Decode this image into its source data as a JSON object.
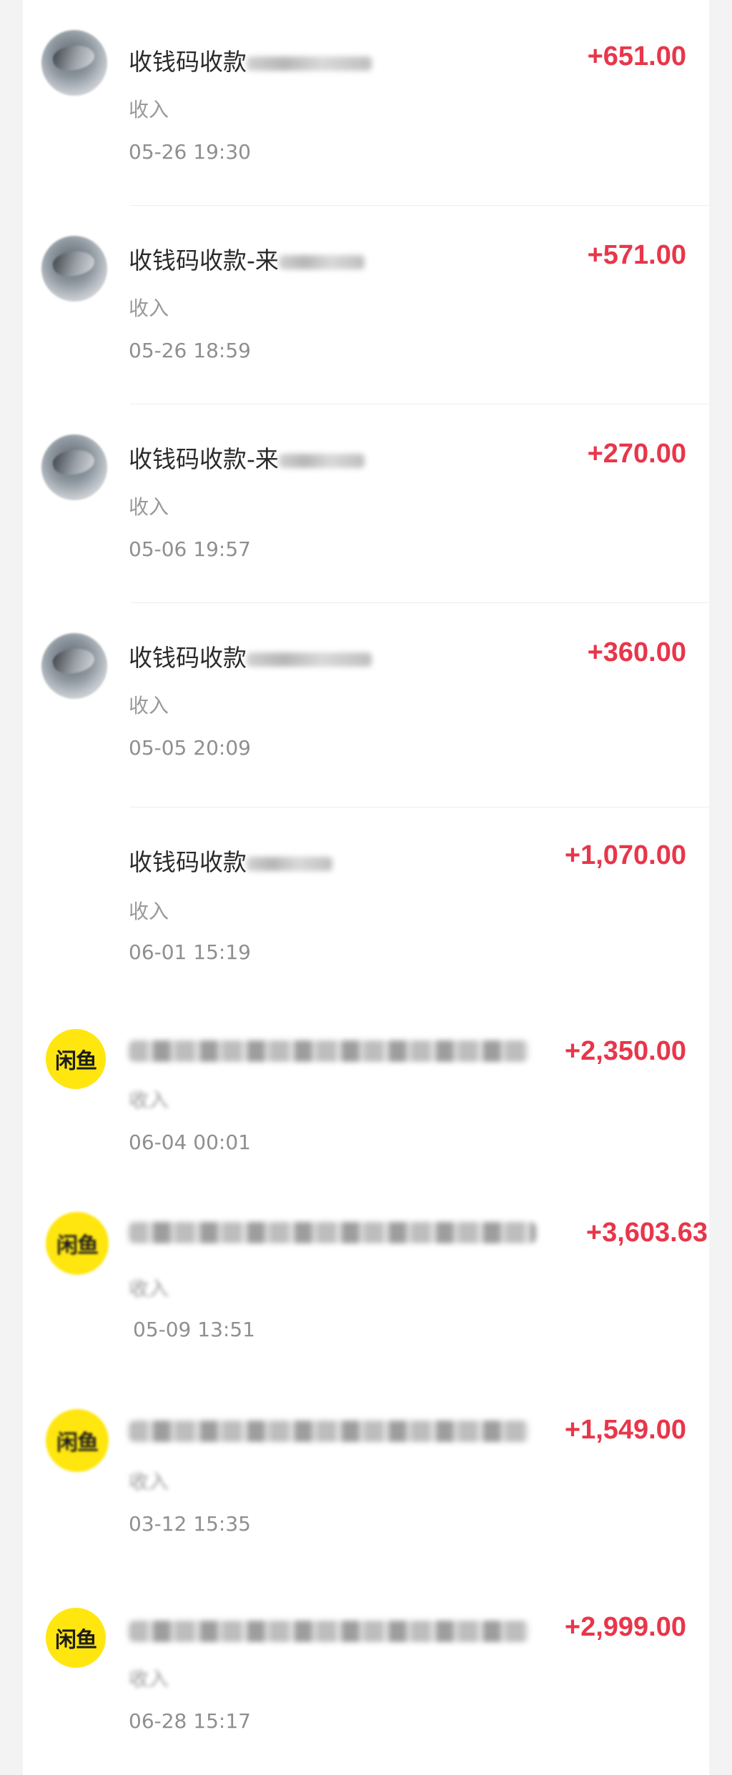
{
  "transactions": [
    {
      "title_prefix": "收钱码收款",
      "subtitle": "收入",
      "time": "05-26 19:30",
      "amount": "+651.00",
      "avatar": "photo"
    },
    {
      "title_prefix": "收钱码收款-来",
      "subtitle": "收入",
      "time": "05-26 18:59",
      "amount": "+571.00",
      "avatar": "photo"
    },
    {
      "title_prefix": "收钱码收款-来",
      "subtitle": "收入",
      "time": "05-06 19:57",
      "amount": "+270.00",
      "avatar": "photo"
    },
    {
      "title_prefix": "收钱码收款",
      "subtitle": "收入",
      "time": "05-05 20:09",
      "amount": "+360.00",
      "avatar": "photo"
    },
    {
      "title_prefix": "收钱码收款",
      "subtitle": "收入",
      "time": "06-01 15:19",
      "amount": "+1,070.00",
      "avatar": "none"
    },
    {
      "title_prefix": "",
      "subtitle": "收入",
      "time": "06-04 00:01",
      "amount": "+2,350.00",
      "avatar": "xianyu"
    },
    {
      "title_prefix": "",
      "subtitle": "收入",
      "time": "05-09 13:51",
      "amount": "+3,603.63",
      "avatar": "xianyu"
    },
    {
      "title_prefix": "",
      "subtitle": "收入",
      "time": "03-12 15:35",
      "amount": "+1,549.00",
      "avatar": "xianyu"
    },
    {
      "title_prefix": "",
      "subtitle": "收入",
      "time": "06-28 15:17",
      "amount": "+2,999.00",
      "avatar": "xianyu"
    }
  ],
  "xianyu_logo": "闲鱼",
  "colors": {
    "amount": "#e8364a",
    "xianyu_yellow": "#ffe60f"
  }
}
